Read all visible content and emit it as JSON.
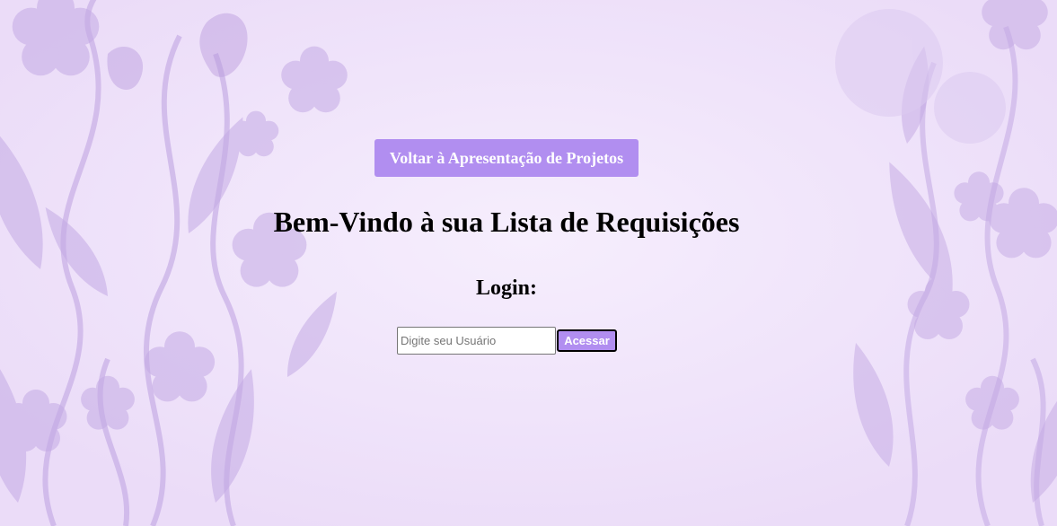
{
  "page": {
    "back_button_label": "Voltar à Apresentação de Projetos",
    "title": "Bem-Vindo à sua Lista de Requisições",
    "login_label": "Login:"
  },
  "form": {
    "username_placeholder": "Digite seu Usuário",
    "username_value": "",
    "submit_label": "Acessar"
  },
  "colors": {
    "background": "#f1e6fb",
    "accent": "#b18ef0",
    "floral": "#c9b0e8"
  }
}
